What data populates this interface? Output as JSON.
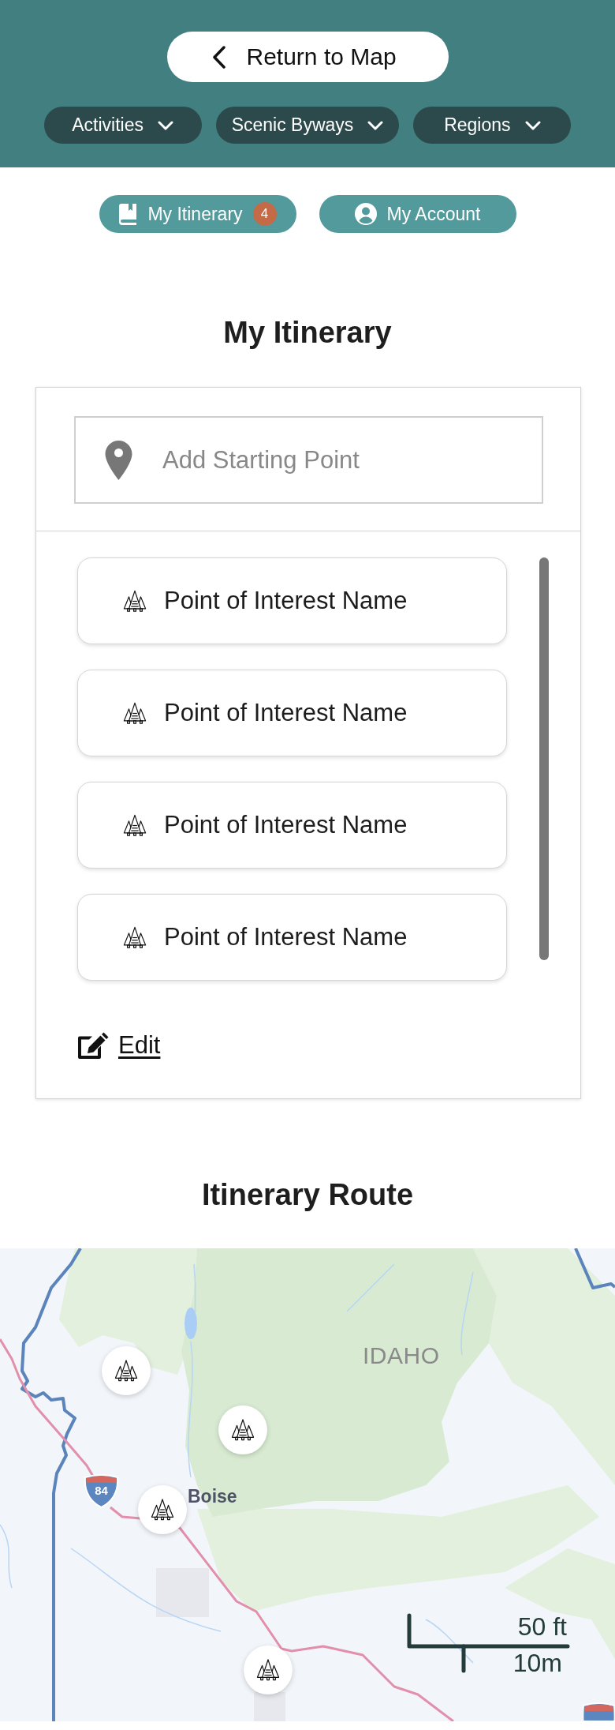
{
  "header": {
    "back_button": {
      "label": "Return to Map"
    },
    "filters": [
      {
        "label": "Activities"
      },
      {
        "label": "Scenic Byways"
      },
      {
        "label": "Regions"
      }
    ]
  },
  "nav": [
    {
      "kind": "itinerary",
      "label": "My Itinerary",
      "badge": "4"
    },
    {
      "kind": "account",
      "label": "My Account"
    }
  ],
  "itinerary": {
    "title": "My Itinerary",
    "start_field": {
      "placeholder": "Add Starting Point"
    },
    "items": [
      {
        "name": "Point of Interest Name"
      },
      {
        "name": "Point of Interest Name"
      },
      {
        "name": "Point of Interest Name"
      },
      {
        "name": "Point of Interest Name"
      }
    ],
    "edit_link": "Edit"
  },
  "route": {
    "title": "Itinerary Route",
    "map": {
      "state_label": "IDAHO",
      "city_label": "Boise",
      "highway_shield": "84",
      "scale": {
        "imperial": "50 ft",
        "metric": "10m"
      }
    }
  }
}
